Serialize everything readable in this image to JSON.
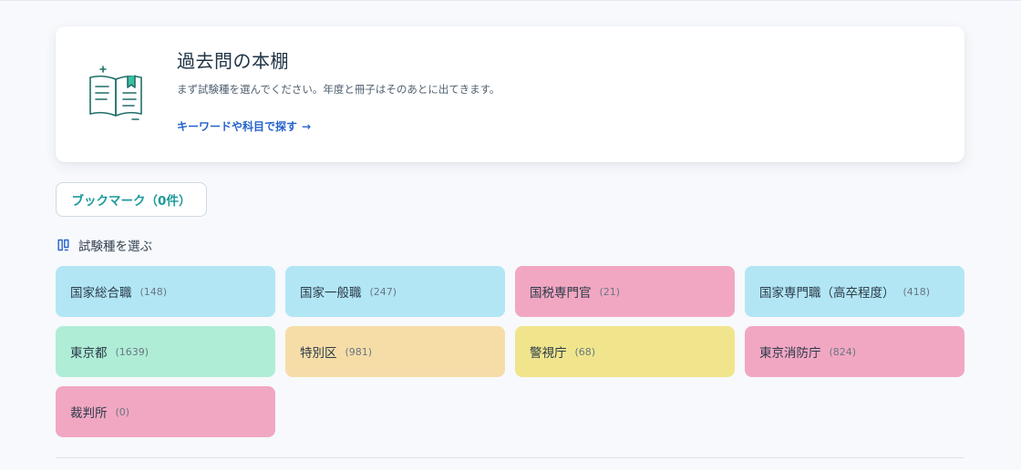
{
  "hero": {
    "title": "過去問の本棚",
    "subtitle": "まず試験種を選んでください。年度と冊子はそのあとに出てきます。",
    "link_label": "キーワードや科目で探す",
    "link_arrow": "→",
    "icon": "open-book-icon"
  },
  "bookmark": {
    "label": "ブックマーク（0件）"
  },
  "section": {
    "icon": "book-stack-icon",
    "title": "試験種を選ぶ"
  },
  "colors": {
    "blue": "#b2e6f5",
    "pink": "#f1a7c2",
    "green": "#afedd6",
    "orange": "#f6dda8",
    "yellow": "#f0e58c",
    "link": "#2563c9",
    "accent_teal": "#1f9a9a"
  },
  "exam_types": [
    {
      "name": "国家総合職",
      "count": "(148)",
      "color": "#b2e6f5"
    },
    {
      "name": "国家一般職",
      "count": "(247)",
      "color": "#b2e6f5"
    },
    {
      "name": "国税専門官",
      "count": "(21)",
      "color": "#f1a7c2"
    },
    {
      "name": "国家専門職（高卒程度）",
      "count": "(418)",
      "color": "#b2e6f5"
    },
    {
      "name": "東京都",
      "count": "(1639)",
      "color": "#afedd6"
    },
    {
      "name": "特別区",
      "count": "(981)",
      "color": "#f6dda8"
    },
    {
      "name": "警視庁",
      "count": "(68)",
      "color": "#f0e58c"
    },
    {
      "name": "東京消防庁",
      "count": "(824)",
      "color": "#f1a7c2"
    },
    {
      "name": "裁判所",
      "count": "(0)",
      "color": "#f1a7c2"
    }
  ]
}
